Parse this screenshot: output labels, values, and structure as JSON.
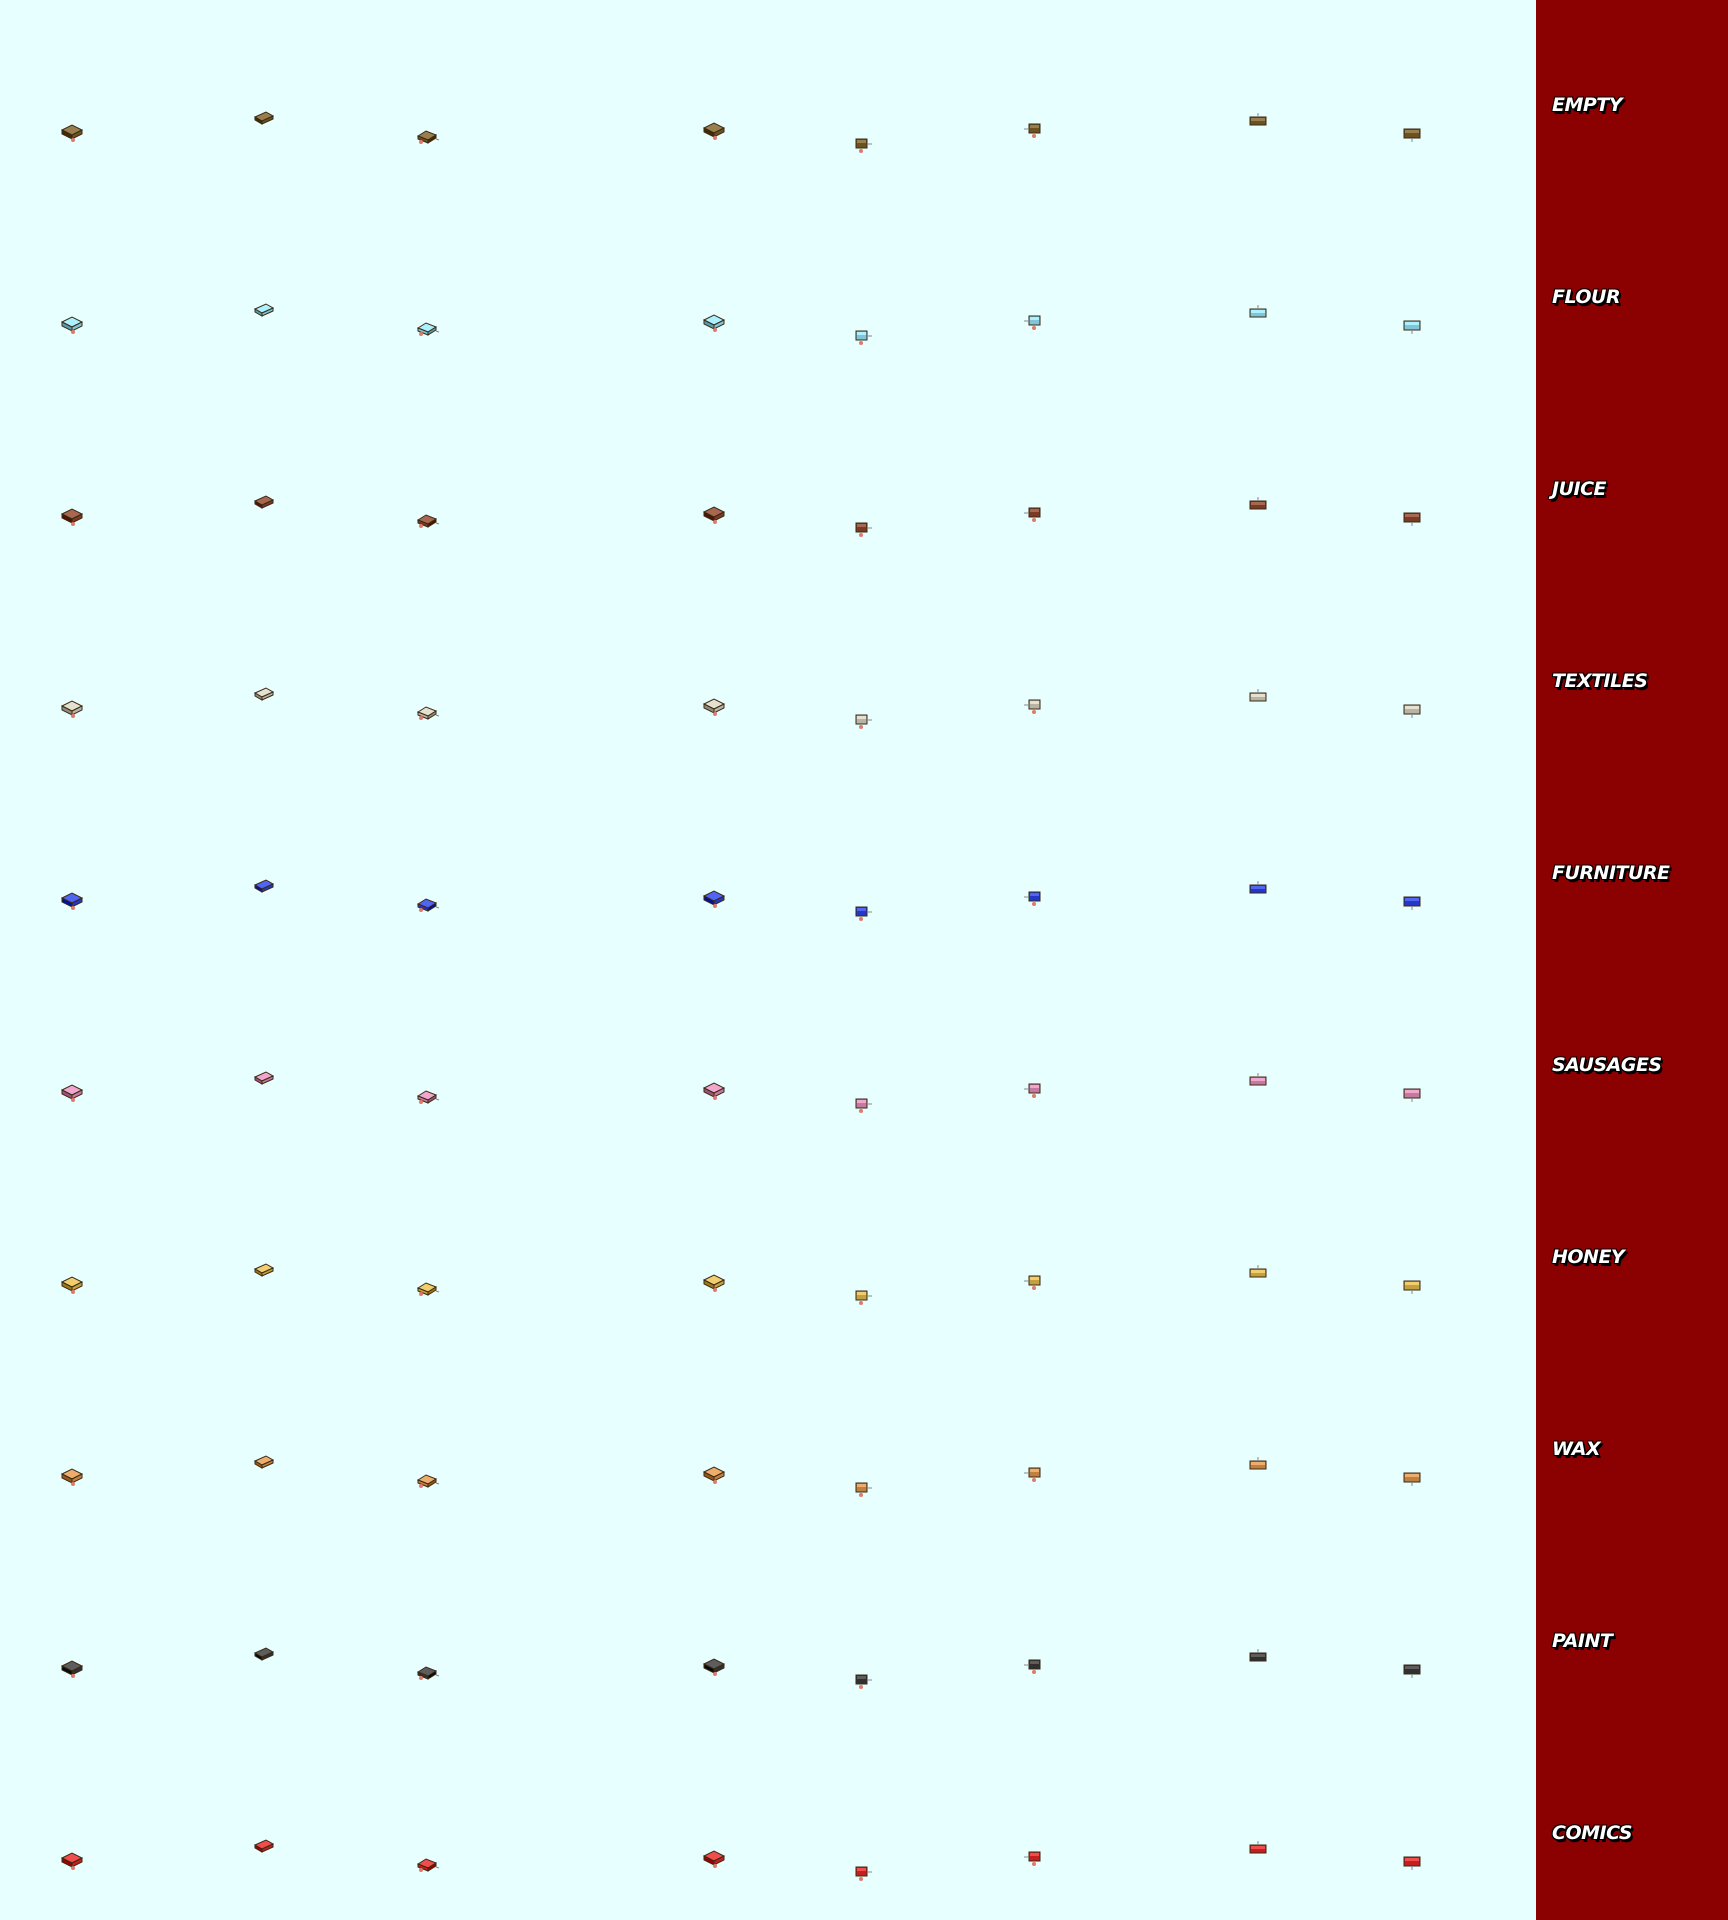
{
  "sheet": {
    "background": "#e8ffff",
    "panel_color": "#8b0000",
    "sprite_views": [
      "diagonal-left",
      "diagonal-up",
      "diagonal-right",
      "diagonal-left-alt",
      "front-small",
      "front",
      "side-top",
      "side"
    ],
    "rows": [
      {
        "label": "EMPTY",
        "color": "#6b5220",
        "icon": "empty-cargo-icon"
      },
      {
        "label": "FLOUR",
        "color": "#7fc4d8",
        "icon": "flour-cargo-icon"
      },
      {
        "label": "JUICE",
        "color": "#7a3a24",
        "icon": "juice-cargo-icon"
      },
      {
        "label": "TEXTILES",
        "color": "#b8b4a4",
        "icon": "textiles-cargo-icon"
      },
      {
        "label": "FURNITURE",
        "color": "#2438c8",
        "icon": "furniture-cargo-icon"
      },
      {
        "label": "SAUSAGES",
        "color": "#c47aa0",
        "icon": "sausages-cargo-icon"
      },
      {
        "label": "HONEY",
        "color": "#c4a040",
        "icon": "honey-cargo-icon"
      },
      {
        "label": "WAX",
        "color": "#c08040",
        "icon": "wax-cargo-icon"
      },
      {
        "label": "PAINT",
        "color": "#303030",
        "icon": "paint-cargo-icon"
      },
      {
        "label": "COMICS",
        "color": "#c42020",
        "icon": "comics-cargo-icon"
      }
    ]
  }
}
